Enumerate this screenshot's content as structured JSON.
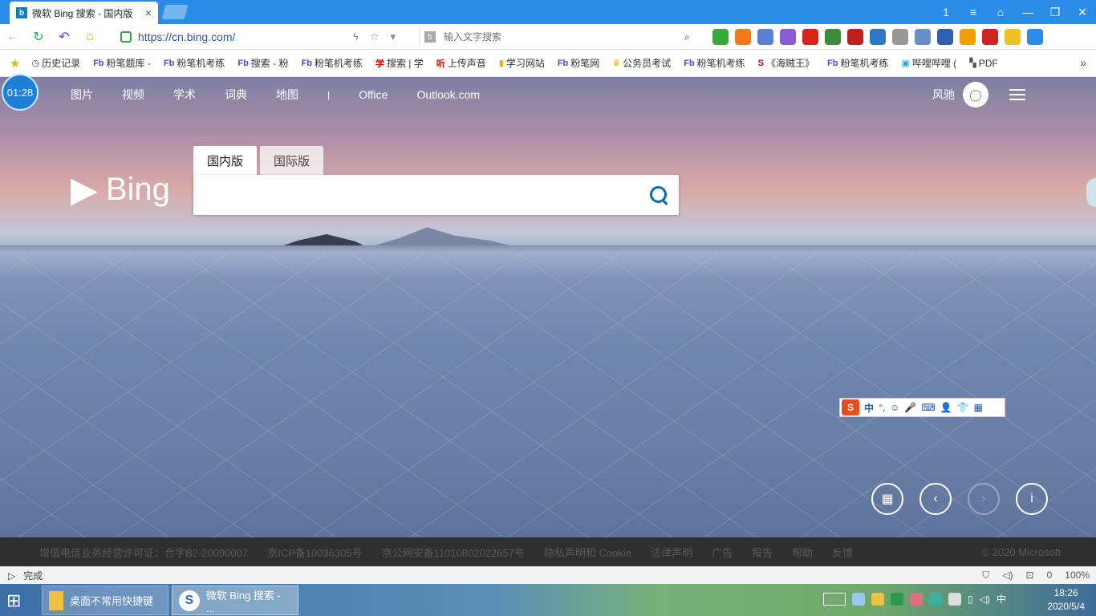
{
  "tab": {
    "title": "微软 Bing 搜索 - 国内版",
    "close": "×"
  },
  "window": {
    "controls": [
      "1",
      "≡",
      "⌂",
      "—",
      "❐",
      "✕"
    ]
  },
  "address": {
    "url": "https://cn.bing.com/",
    "search_placeholder": "输入文字搜索"
  },
  "bookmarks": [
    {
      "icon": "clock-icon",
      "glyph": "◷",
      "label": "历史记录"
    },
    {
      "icon": "fenbi-icon",
      "glyph": "Fb",
      "label": "粉笔题库 -"
    },
    {
      "icon": "fenbi-icon",
      "glyph": "Fb",
      "label": "粉笔机考练"
    },
    {
      "icon": "fenbi-icon",
      "glyph": "Fb",
      "label": "搜索 - 粉"
    },
    {
      "icon": "fenbi-icon",
      "glyph": "Fb",
      "label": "粉笔机考练"
    },
    {
      "icon": "red-icon",
      "glyph": "学",
      "label": "搜索 | 学"
    },
    {
      "icon": "red-icon",
      "glyph": "听",
      "label": "上传声音"
    },
    {
      "icon": "folder-icon",
      "glyph": "▮",
      "label": "学习网站"
    },
    {
      "icon": "fenbi-icon",
      "glyph": "Fb",
      "label": "粉笔网"
    },
    {
      "icon": "folder-icon",
      "glyph": "♛",
      "label": "公务员考试"
    },
    {
      "icon": "fenbi-icon",
      "glyph": "Fb",
      "label": "粉笔机考练"
    },
    {
      "icon": "sogou-icon",
      "glyph": "S",
      "label": "《海贼王》"
    },
    {
      "icon": "fenbi-icon",
      "glyph": "Fb",
      "label": "粉笔机考练"
    },
    {
      "icon": "bilibili-icon",
      "glyph": "▣",
      "label": "哔哩哔哩 ("
    },
    {
      "icon": "pdf-icon",
      "glyph": "▚",
      "label": "PDF"
    }
  ],
  "timer": "01:28",
  "topnav": {
    "items": [
      "图片",
      "视频",
      "学术",
      "词典",
      "地图"
    ],
    "separator": "|",
    "office": "Office",
    "outlook": "Outlook.com"
  },
  "user": {
    "name": "风驰"
  },
  "logo": {
    "text": "Bing"
  },
  "search": {
    "tab_domestic": "国内版",
    "tab_international": "国际版",
    "value": ""
  },
  "ime": {
    "zh": "中",
    "items": [
      "°,",
      "☺",
      "🎤",
      "⌨",
      "👤",
      "👕",
      "▦"
    ]
  },
  "footer": {
    "links": [
      "增值电信业务经营许可证：合字B2-20090007",
      "京ICP备10036305号",
      "京公网安备11010802022657号",
      "隐私声明和 Cookie",
      "法律声明",
      "广告",
      "报告",
      "帮助",
      "反馈"
    ],
    "copyright": "© 2020 Microsoft"
  },
  "status": {
    "text": "完成",
    "zoom": "100%",
    "count": "0"
  },
  "taskbar": {
    "folder_label": "桌面不常用快捷键",
    "browser_label": "微软 Bing 搜索 - ...",
    "ime": "中",
    "time": "18:26",
    "date": "2020/5/4"
  },
  "colors": {
    "tab_strip": "#2b8ce8",
    "bing_blue": "#0c6bb0",
    "footer_bg": "#2f2f30"
  }
}
